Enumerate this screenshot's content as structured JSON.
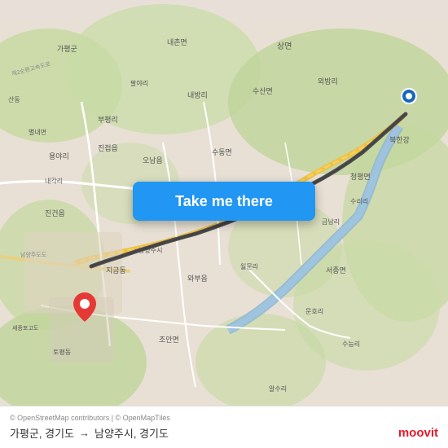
{
  "map": {
    "attribution": "© OpenStreetMap contributors | © OpenMapTiles",
    "route_line_color": "#555555",
    "water_color": "#aacce8",
    "terrain_color": "#c8d8a8"
  },
  "button": {
    "label": "Take me there",
    "background": "#2196F3"
  },
  "route": {
    "origin": "가평군, 경기도",
    "destination": "남양주시, 경기도",
    "arrow": "→"
  },
  "branding": {
    "name": "moovit",
    "attribution": "© OpenStreetMap contributors | © OpenMapTiles"
  },
  "markers": {
    "origin_color": "#e53935",
    "destination_color": "#1565C0"
  }
}
